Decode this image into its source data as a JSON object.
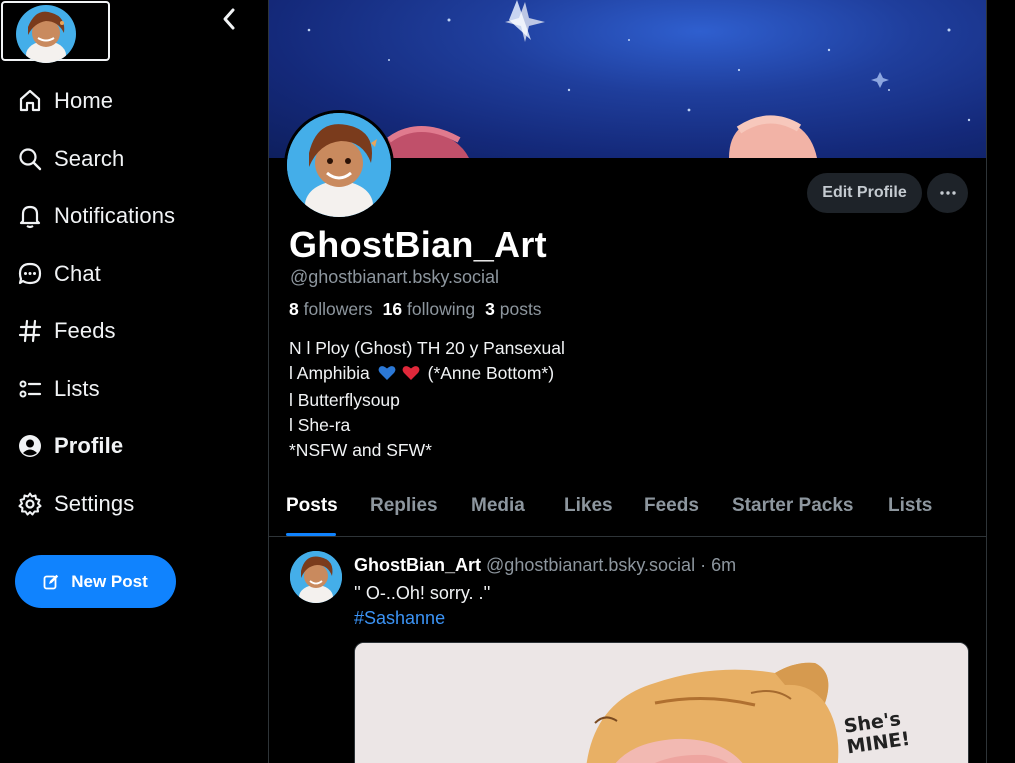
{
  "sidebar": {
    "collapse_icon": "chevron-left-icon",
    "nav": [
      {
        "label": "Home",
        "icon": "home-icon"
      },
      {
        "label": "Search",
        "icon": "search-icon"
      },
      {
        "label": "Notifications",
        "icon": "bell-icon"
      },
      {
        "label": "Chat",
        "icon": "chat-icon"
      },
      {
        "label": "Feeds",
        "icon": "hash-icon"
      },
      {
        "label": "Lists",
        "icon": "list-icon"
      },
      {
        "label": "Profile",
        "icon": "user-icon",
        "active": true
      },
      {
        "label": "Settings",
        "icon": "gear-icon"
      }
    ],
    "new_post_label": "New Post"
  },
  "profile": {
    "edit_label": "Edit Profile",
    "display_name": "GhostBian_Art",
    "handle": "@ghostbianart.bsky.social",
    "followers_count": "8",
    "followers_label": "followers",
    "following_count": "16",
    "following_label": "following",
    "posts_count": "3",
    "posts_label": "posts",
    "bio": {
      "line1": "N l Ploy (Ghost) TH 20 y Pansexual",
      "line2_prefix": "l Amphibia",
      "line2_suffix": "(*Anne Bottom*)",
      "line3": "l Butterflysoup",
      "line4": "l She-ra",
      "line5": "*NSFW and SFW*"
    }
  },
  "tabs": [
    "Posts",
    "Replies",
    "Media",
    "Likes",
    "Feeds",
    "Starter Packs",
    "Lists"
  ],
  "post": {
    "author": "GhostBian_Art",
    "handle": "@ghostbianart.bsky.social",
    "separator": "·",
    "time": "6m",
    "text": "'' O-..Oh! sorry. .''",
    "hashtag": "#Sashanne",
    "image_caption": "She's MINE!"
  },
  "colors": {
    "accent": "#1083fe",
    "muted": "#8d969e",
    "background": "#000000"
  }
}
